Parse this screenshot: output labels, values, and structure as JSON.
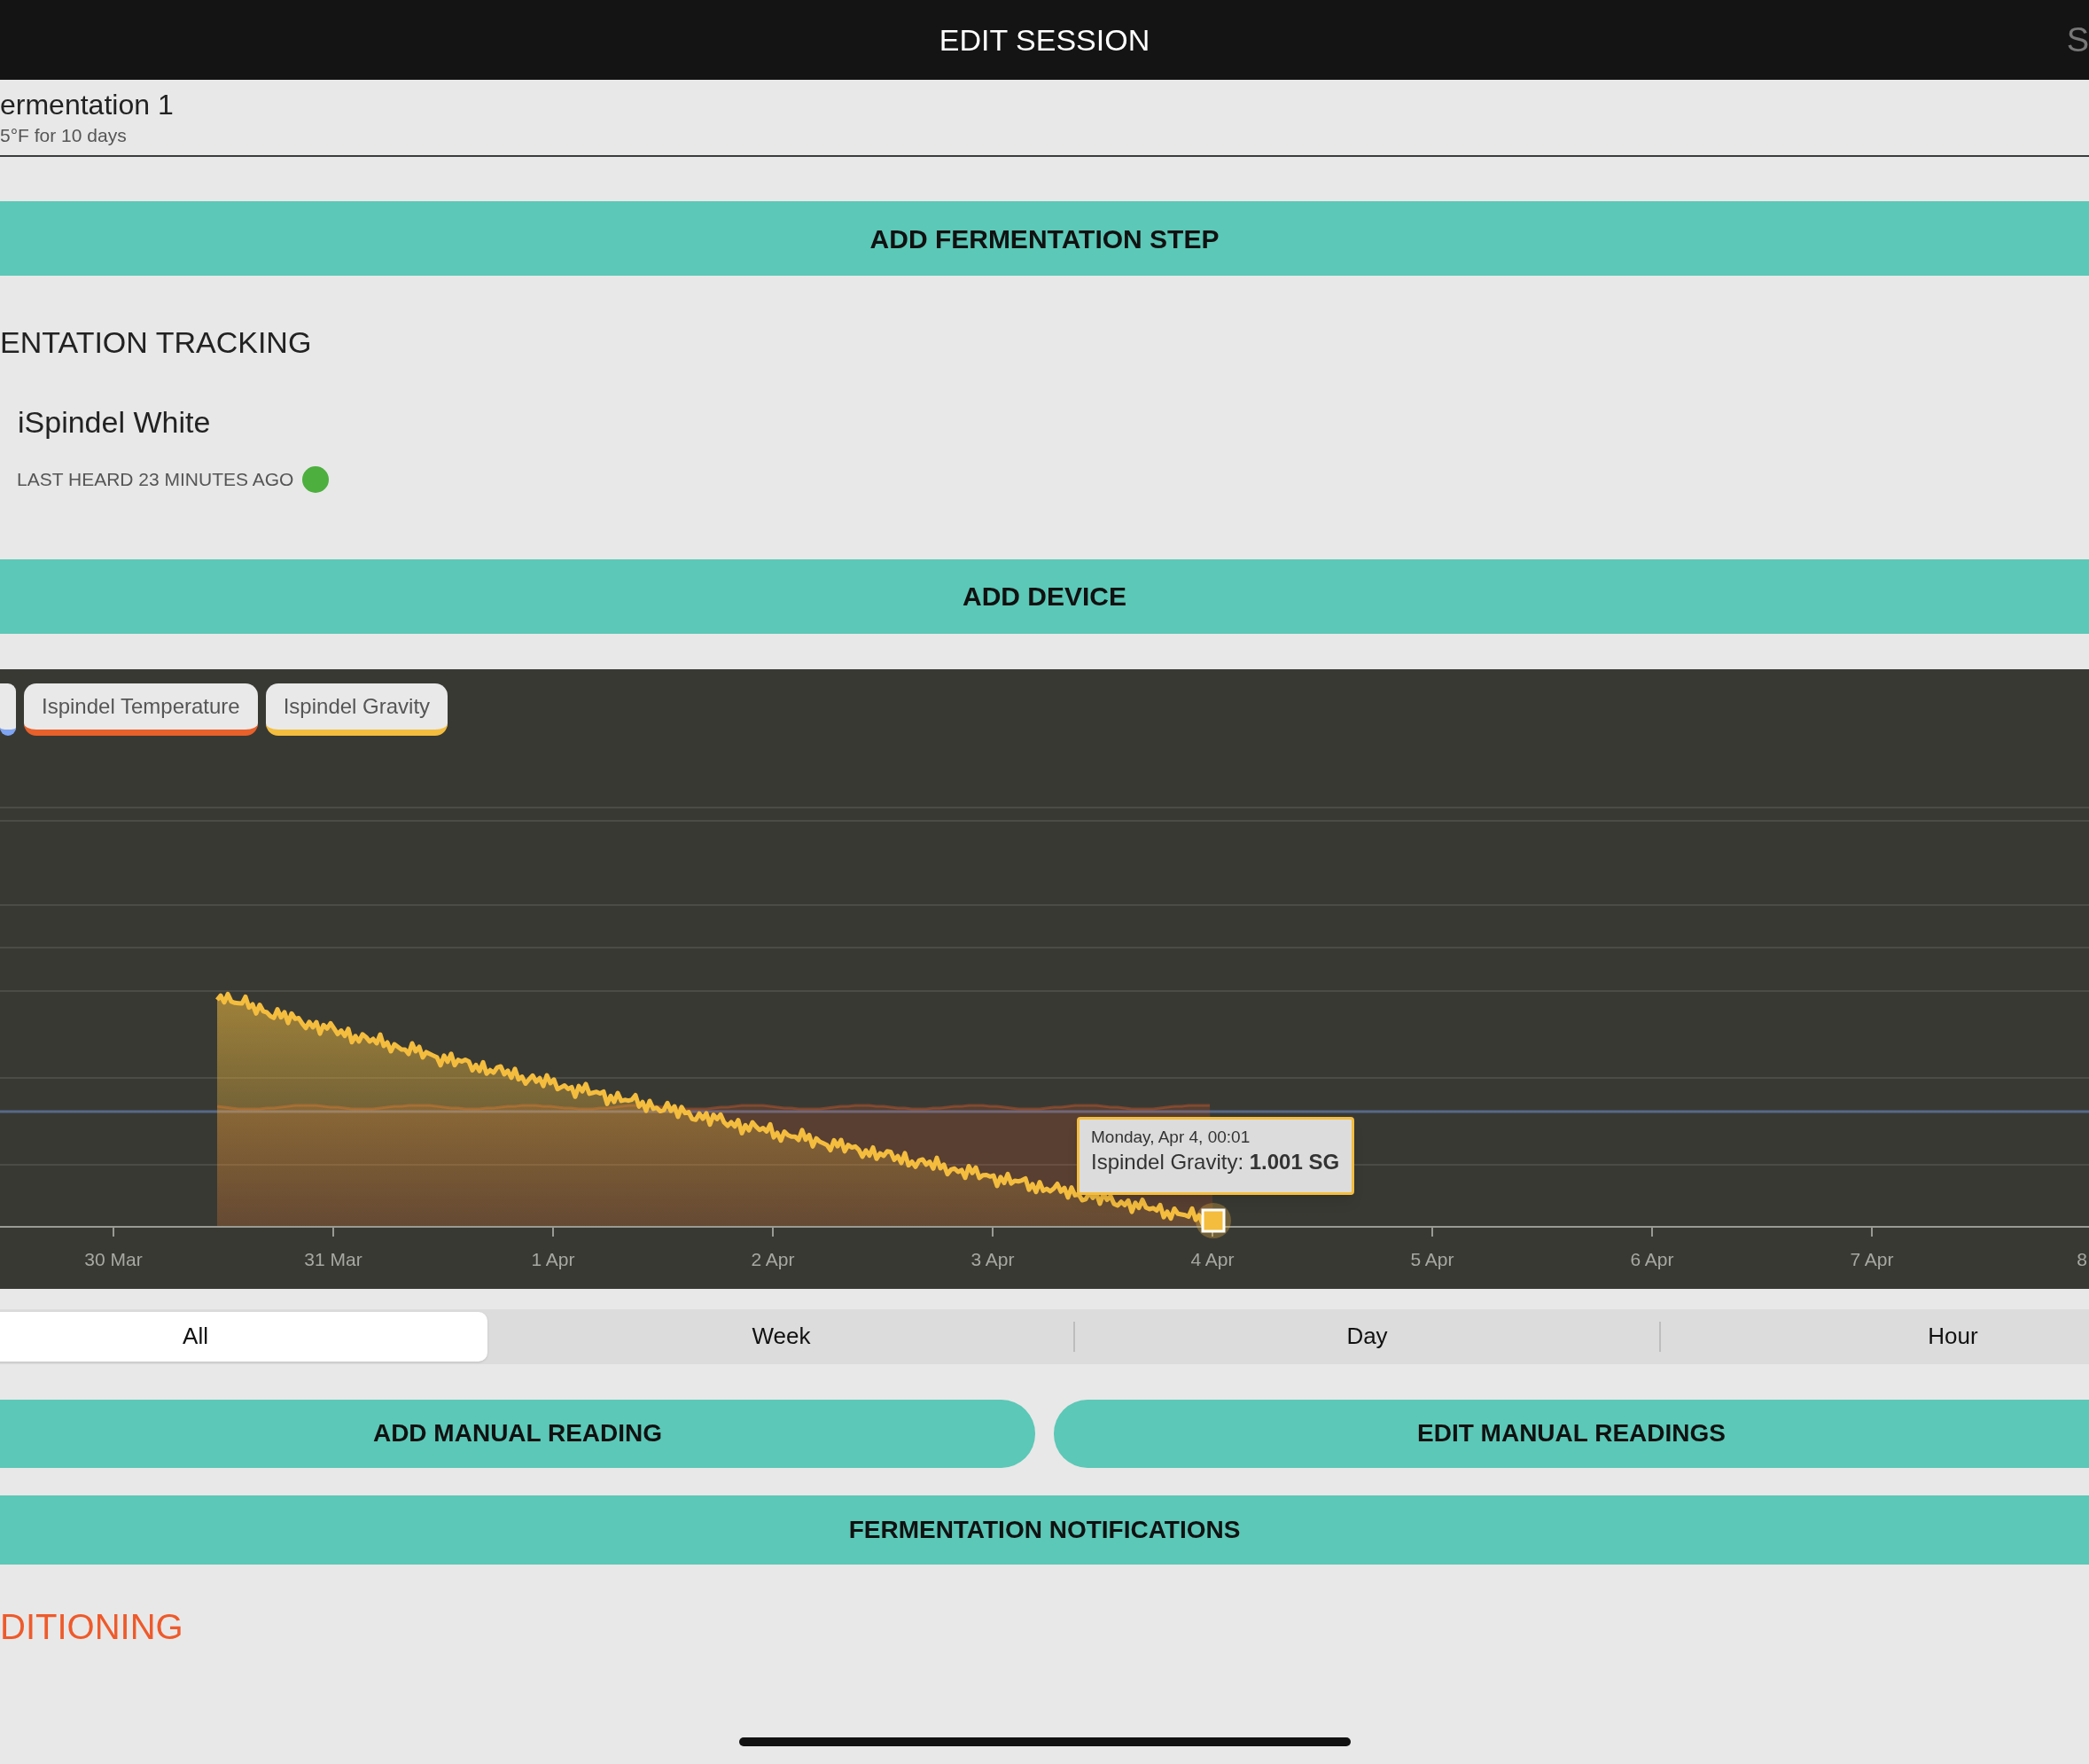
{
  "header": {
    "title": "EDIT SESSION",
    "right_action": "S"
  },
  "fermentation_step": {
    "name": "ermentation 1",
    "detail": "5°F for 10 days"
  },
  "add_step_button": "ADD FERMENTATION STEP",
  "tracking": {
    "heading": "ENTATION TRACKING",
    "device": {
      "name": "iSpindel White",
      "status": "LAST HEARD 23 MINUTES AGO",
      "online": true
    }
  },
  "add_device_button": "ADD DEVICE",
  "chart": {
    "legend": [
      {
        "color": "#7ea4f2"
      },
      {
        "label": "Ispindel Temperature",
        "color": "#e8602a"
      },
      {
        "label": "Ispindel Gravity",
        "color": "#f4bd3e"
      }
    ],
    "x_labels": [
      "30 Mar",
      "31 Mar",
      "1 Apr",
      "2 Apr",
      "3 Apr",
      "4 Apr",
      "5 Apr",
      "6 Apr",
      "7 Apr",
      "8"
    ],
    "tooltip": {
      "date": "Monday, Apr 4, 00:01",
      "text": "Ispindel Gravity: **1.001 SG**"
    }
  },
  "ranges": [
    {
      "label": "All",
      "selected": true
    },
    {
      "label": "Week",
      "selected": false
    },
    {
      "label": "Day",
      "selected": false
    },
    {
      "label": "Hour",
      "selected": false
    }
  ],
  "manual_buttons": [
    "ADD MANUAL READING",
    "EDIT MANUAL READINGS"
  ],
  "notifications_button": "FERMENTATION NOTIFICATIONS",
  "next_heading": "DITIONING"
}
